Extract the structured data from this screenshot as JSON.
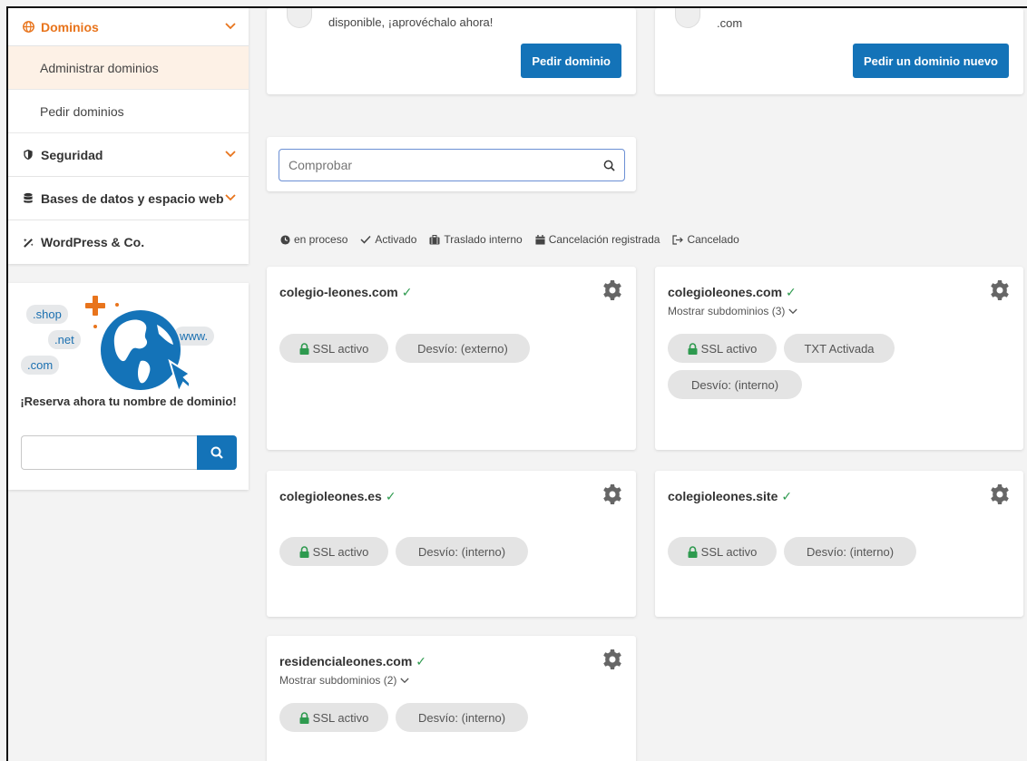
{
  "sidebar": {
    "items": [
      {
        "label": "Dominios",
        "icon": "globe-icon"
      },
      {
        "label": "Administrar dominios"
      },
      {
        "label": "Pedir dominios"
      },
      {
        "label": "Seguridad",
        "icon": "shield-icon"
      },
      {
        "label": "Bases de datos y espacio web",
        "icon": "database-icon"
      },
      {
        "label": "WordPress & Co.",
        "icon": "magic-wand-icon"
      }
    ],
    "promo": {
      "tlds": [
        ".shop",
        ".net",
        ".com",
        "www."
      ],
      "text": "¡Reserva ahora tu nombre de dominio!",
      "search_placeholder": ""
    }
  },
  "top_cards": [
    {
      "text": "disponible, ¡aprovéchalo ahora!",
      "button": "Pedir dominio"
    },
    {
      "text": ".com",
      "button": "Pedir un dominio nuevo"
    }
  ],
  "check": {
    "placeholder": "Comprobar"
  },
  "legend": [
    {
      "label": "en proceso",
      "icon": "clock-icon"
    },
    {
      "label": "Activado",
      "icon": "check-icon"
    },
    {
      "label": "Traslado interno",
      "icon": "suitcase-icon"
    },
    {
      "label": "Cancelación registrada",
      "icon": "calendar-icon"
    },
    {
      "label": "Cancelado",
      "icon": "sign-out-icon"
    }
  ],
  "domains": [
    {
      "name": "colegio-leones.com",
      "subdomains": "",
      "tags": [
        "SSL activo",
        "Desvío: (externo)"
      ]
    },
    {
      "name": "colegioleones.com",
      "subdomains": "Mostrar subdominios (3)",
      "tags": [
        "SSL activo",
        "TXT Activada",
        "Desvío: (interno)"
      ]
    },
    {
      "name": "colegioleones.es",
      "subdomains": "",
      "tags": [
        "SSL activo",
        "Desvío: (interno)"
      ]
    },
    {
      "name": "colegioleones.site",
      "subdomains": "",
      "tags": [
        "SSL activo",
        "Desvío: (interno)"
      ]
    },
    {
      "name": "residencialeones.com",
      "subdomains": "Mostrar subdominios (2)",
      "tags": [
        "SSL activo",
        "Desvío: (interno)"
      ]
    }
  ],
  "colors": {
    "accent": "#e8741c",
    "primary": "#1473b8",
    "success": "#2e9a4f"
  }
}
